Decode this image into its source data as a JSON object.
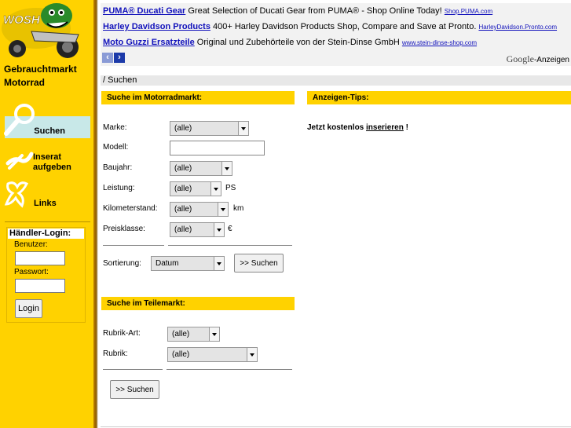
{
  "sidebar": {
    "brand_line1": "Gebrauchtmarkt",
    "brand_line2": "Motorrad",
    "nav": [
      {
        "label": "Suchen",
        "icon": "magnifier-icon"
      },
      {
        "label": "Inserat aufgeben",
        "icon": "pen-icon"
      },
      {
        "label": "Links",
        "icon": "links-icon"
      }
    ],
    "login": {
      "title": "Händler-Login:",
      "user_label": "Benutzer:",
      "pass_label": "Passwort:",
      "button": "Login"
    }
  },
  "ads": [
    {
      "title": "PUMA® Ducati Gear",
      "text": " Great Selection of Ducati Gear from PUMA® - Shop Online Today! ",
      "url": "Shop.PUMA.com"
    },
    {
      "title": "Harley Davidson Products",
      "text": " 400+ Harley Davidson Products Shop, Compare and Save at Pronto. ",
      "url": "HarleyDavidson.Pronto.com"
    },
    {
      "title": "Moto Guzzi Ersatzteile",
      "text": " Original und Zubehörteile von der Stein-Dinse GmbH ",
      "url": "www.stein-dinse-shop.com"
    }
  ],
  "ads_footer": {
    "google": "Google",
    "suffix": "-Anzeigen"
  },
  "breadcrumb": "/ Suchen",
  "motorrad": {
    "header": "Suche im Motorradmarkt:",
    "marke_label": "Marke:",
    "marke_value": "(alle)",
    "modell_label": "Modell:",
    "modell_value": "",
    "baujahr_label": "Baujahr:",
    "baujahr_value": "(alle)",
    "leistung_label": "Leistung:",
    "leistung_value": "(alle)",
    "leistung_unit": "PS",
    "km_label": "Kilometerstand:",
    "km_value": "(alle)",
    "km_unit": "km",
    "preis_label": "Preisklasse:",
    "preis_value": "(alle)",
    "preis_unit": "€",
    "sort_label": "Sortierung:",
    "sort_value": "Datum",
    "search_button": ">> Suchen"
  },
  "tips": {
    "header": "Anzeigen-Tips:",
    "text_before": "Jetzt kostenlos ",
    "link": "inserieren",
    "text_after": " !"
  },
  "teile": {
    "header": "Suche im Teilemarkt:",
    "rubrikart_label": "Rubrik-Art:",
    "rubrikart_value": "(alle)",
    "rubrik_label": "Rubrik:",
    "rubrik_value": "(alle)",
    "search_button": ">> Suchen"
  },
  "colors": {
    "sidebar": "#ffd200",
    "link": "#1111bb"
  }
}
